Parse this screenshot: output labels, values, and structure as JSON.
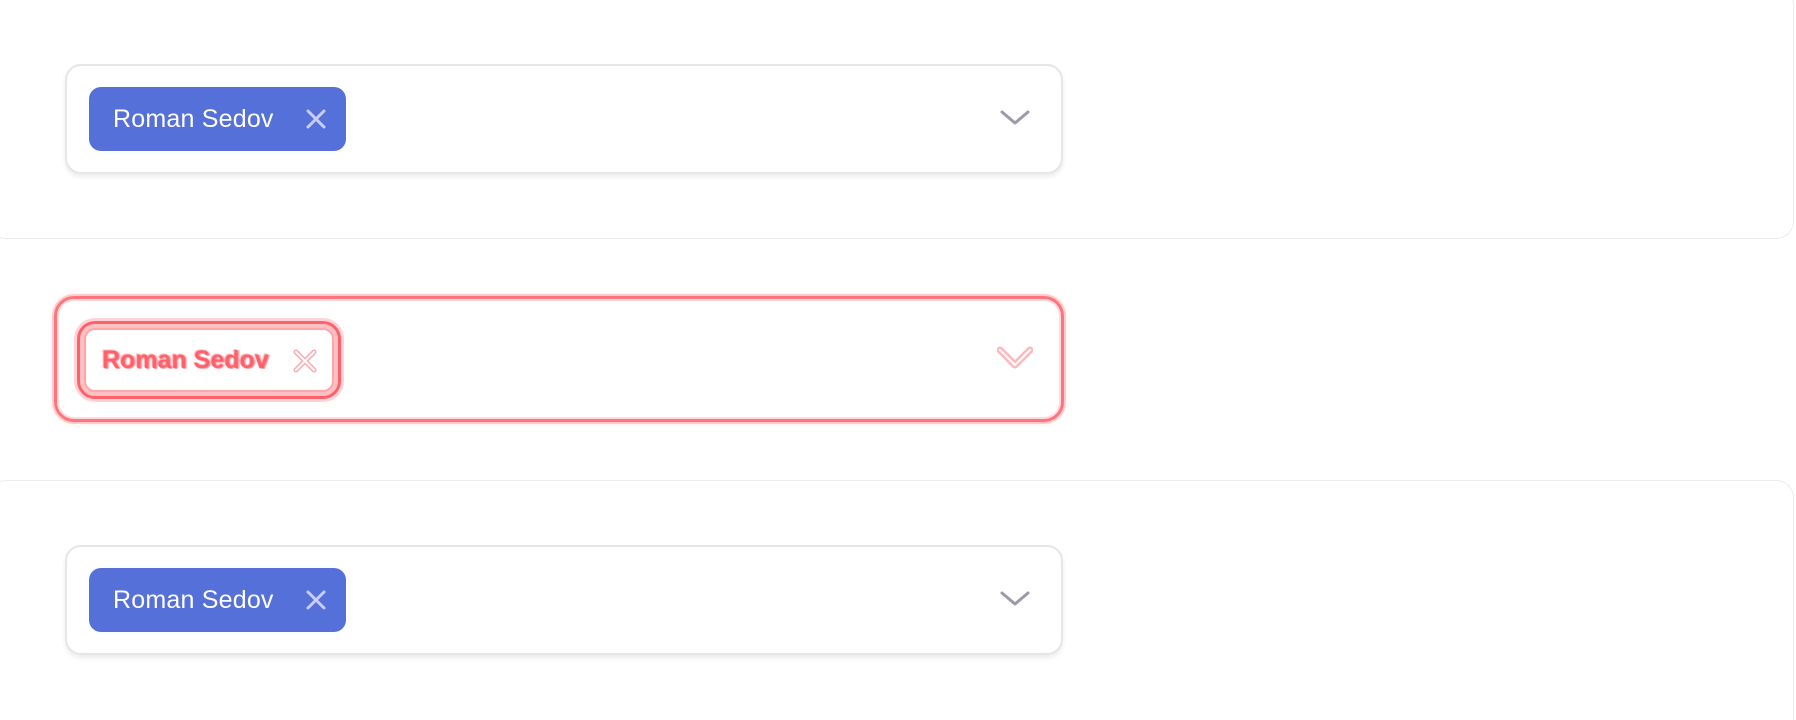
{
  "colors": {
    "chip_bg": "#5670d9",
    "chip_text": "#ffffff",
    "chevron": "#9a9aa8",
    "ghost_red": "#ff4652"
  },
  "selects": [
    {
      "chip_label": "Roman Sedov",
      "remove_icon": "close-icon",
      "toggle_icon": "chevron-down-icon"
    },
    {
      "chip_label": "Roman Sedov",
      "remove_icon": "close-icon",
      "toggle_icon": "chevron-down-icon"
    },
    {
      "chip_label": "Roman Sedov",
      "remove_icon": "close-icon",
      "toggle_icon": "chevron-down-icon"
    }
  ]
}
